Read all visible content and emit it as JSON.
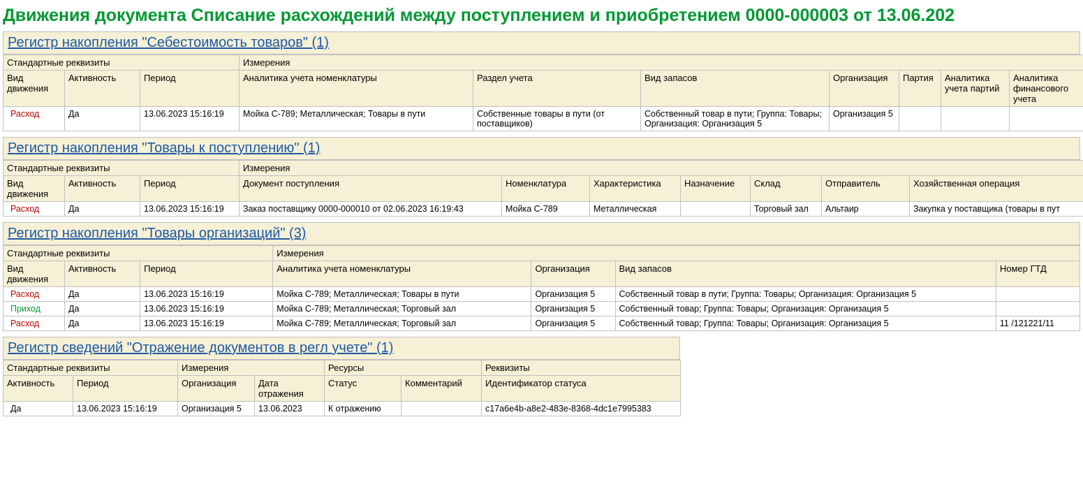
{
  "title": "Движения документа Списание расхождений между поступлением и приобретением 0000-000003 от 13.06.202",
  "labels": {
    "std_req": "Стандартные реквизиты",
    "dimensions": "Измерения",
    "resources": "Ресурсы",
    "requisites": "Реквизиты",
    "movement_type": "Вид движения",
    "activity": "Активность",
    "period": "Период",
    "analytics_nomen": "Аналитика учета номенклатуры",
    "section": "Раздел учета",
    "stock_type": "Вид запасов",
    "organization": "Организация",
    "batch": "Партия",
    "analytics_batch": "Аналитика учета партий",
    "analytics_fin": "Аналитика финансового учета",
    "doc_receipt": "Документ поступления",
    "nomenclature": "Номенклатура",
    "characteristic": "Характеристика",
    "purpose": "Назначение",
    "warehouse": "Склад",
    "sender": "Отправитель",
    "business_op": "Хозяйственная операция",
    "gtd": "Номер ГТД",
    "reflect_date": "Дата отражения",
    "status": "Статус",
    "comment": "Комментарий",
    "status_id": "Идентификатор статуса"
  },
  "s1": {
    "heading": "Регистр накопления \"Себестоимость товаров\" (1)",
    "rows": [
      {
        "mv": "Расход",
        "mv_kind": "expense",
        "active": "Да",
        "period": "13.06.2023 15:16:19",
        "analytics": "Мойка C-789; Металлическая; Товары в пути",
        "section": "Собственные товары в пути (от поставщиков)",
        "stock": "Собственный товар в пути; Группа: Товары; Организация: Организация 5",
        "org": "Организация 5",
        "batch": "",
        "abatch": "",
        "afin": ""
      }
    ]
  },
  "s2": {
    "heading": "Регистр накопления \"Товары к поступлению\" (1)",
    "rows": [
      {
        "mv": "Расход",
        "mv_kind": "expense",
        "active": "Да",
        "period": "13.06.2023 15:16:19",
        "doc": "Заказ поставщику 0000-000010 от 02.06.2023 16:19:43",
        "nomen": "Мойка C-789",
        "char": "Металлическая",
        "purpose": "",
        "wh": "Торговый зал",
        "sender": "Альтаир",
        "op": "Закупка у поставщика (товары в пут"
      }
    ]
  },
  "s3": {
    "heading": "Регистр накопления \"Товары организаций\" (3)",
    "rows": [
      {
        "mv": "Расход",
        "mv_kind": "expense",
        "active": "Да",
        "period": "13.06.2023 15:16:19",
        "analytics": "Мойка C-789; Металлическая; Товары в пути",
        "org": "Организация 5",
        "stock": "Собственный товар в пути; Группа: Товары; Организация: Организация 5",
        "gtd": ""
      },
      {
        "mv": "Приход",
        "mv_kind": "income",
        "active": "Да",
        "period": "13.06.2023 15:16:19",
        "analytics": "Мойка C-789; Металлическая; Торговый зал",
        "org": "Организация 5",
        "stock": "Собственный товар; Группа: Товары; Организация: Организация 5",
        "gtd": ""
      },
      {
        "mv": "Расход",
        "mv_kind": "expense",
        "active": "Да",
        "period": "13.06.2023 15:16:19",
        "analytics": "Мойка C-789; Металлическая; Торговый зал",
        "org": "Организация 5",
        "stock": "Собственный товар; Группа: Товары; Организация: Организация 5",
        "gtd": "11    /121221/11"
      }
    ]
  },
  "s4": {
    "heading": "Регистр сведений \"Отражение документов в регл учете\" (1)",
    "rows": [
      {
        "active": "Да",
        "period": "13.06.2023 15:16:19",
        "org": "Организация 5",
        "date": "13.06.2023",
        "status": "К отражению",
        "comment": "",
        "sid": "c17a6e4b-a8e2-483e-8368-4dc1e7995383"
      }
    ]
  }
}
